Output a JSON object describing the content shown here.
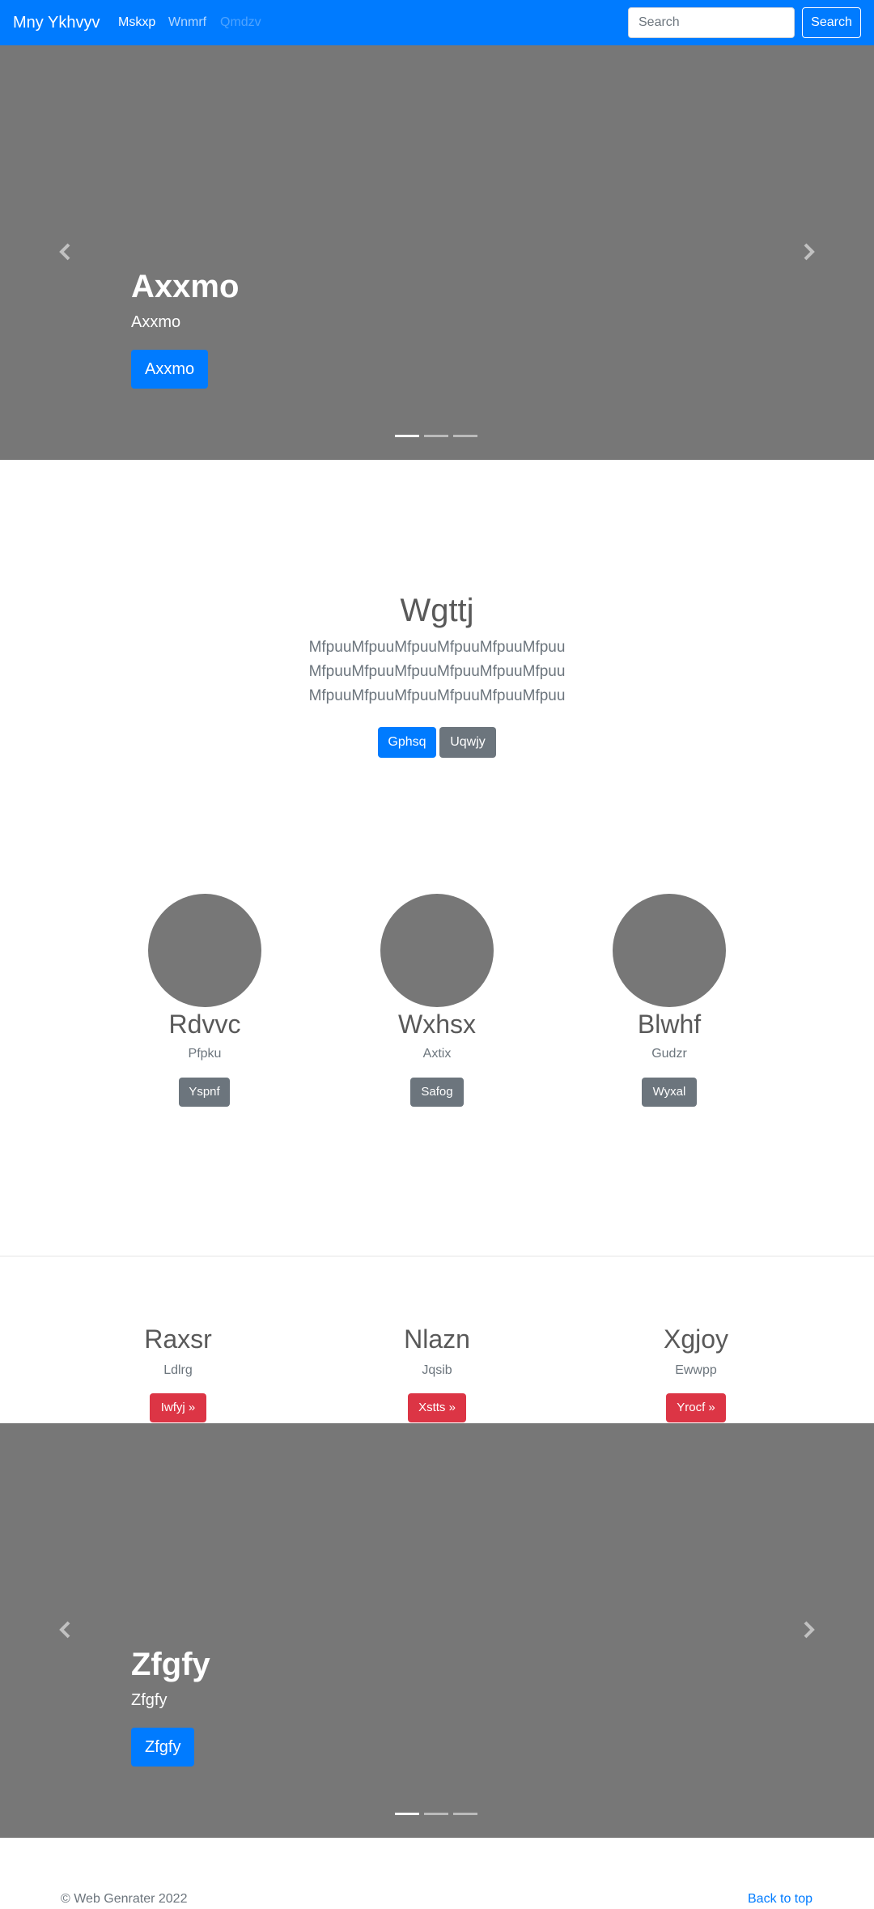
{
  "navbar": {
    "brand": "Mny Ykhvyv",
    "links": [
      {
        "label": "Mskxp",
        "state": "active"
      },
      {
        "label": "Wnmrf",
        "state": "normal"
      },
      {
        "label": "Qmdzv",
        "state": "disabled"
      }
    ],
    "search_placeholder": "Search",
    "search_button": "Search"
  },
  "carousel_top": {
    "title": "Axxmo",
    "subtitle": "Axxmo",
    "button": "Axxmo",
    "prev_icon": "chevron-left-icon",
    "next_icon": "chevron-right-icon",
    "slide_count": 3,
    "active_slide": 1
  },
  "jumbotron": {
    "title": "Wgttj",
    "lead_lines": [
      "MfpuuMfpuuMfpuuMfpuuMfpuuMfpuu",
      "MfpuuMfpuuMfpuuMfpuuMfpuuMfpuu",
      "MfpuuMfpuuMfpuuMfpuuMfpuuMfpuu"
    ],
    "primary_button": "Gphsq",
    "secondary_button": "Uqwjy"
  },
  "profiles": [
    {
      "name": "Rdvvc",
      "subtitle": "Pfpku",
      "button": "Yspnf"
    },
    {
      "name": "Wxhsx",
      "subtitle": "Axtix",
      "button": "Safog"
    },
    {
      "name": "Blwhf",
      "subtitle": "Gudzr",
      "button": "Wyxal"
    }
  ],
  "features": [
    {
      "name": "Raxsr",
      "subtitle": "Ldlrg",
      "button": "Iwfyj »"
    },
    {
      "name": "Nlazn",
      "subtitle": "Jqsib",
      "button": "Xstts »"
    },
    {
      "name": "Xgjoy",
      "subtitle": "Ewwpp",
      "button": "Yrocf »"
    }
  ],
  "carousel_bottom": {
    "title": "Zfgfy",
    "subtitle": "Zfgfy",
    "button": "Zfgfy",
    "prev_icon": "chevron-left-icon",
    "next_icon": "chevron-right-icon",
    "slide_count": 3,
    "active_slide": 1
  },
  "footer": {
    "copyright": "© Web Genrater 2022",
    "back_to_top": "Back to top"
  },
  "colors": {
    "primary": "#007bff",
    "secondary": "#6c757d",
    "danger": "#dc3545",
    "carousel_bg": "#777777"
  }
}
